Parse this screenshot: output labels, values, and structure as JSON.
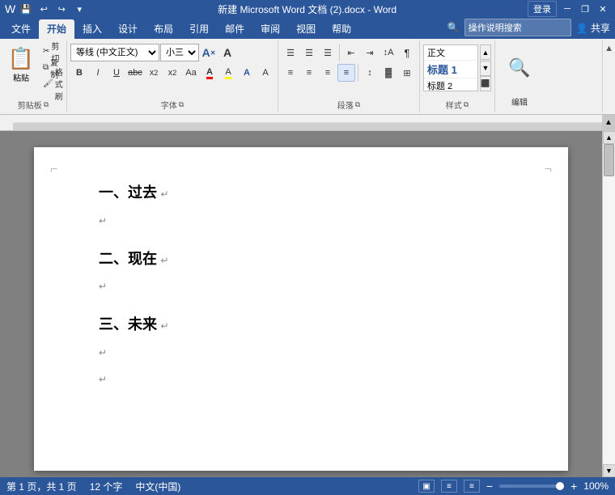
{
  "titlebar": {
    "title": "新建 Microsoft Word 文档 (2).docx - Word",
    "login_label": "登录",
    "app_name": "Word",
    "icons": {
      "save": "💾",
      "undo": "↩",
      "redo": "↪",
      "customize": "▼"
    },
    "window_controls": {
      "minimize": "─",
      "maximize": "□",
      "close": "✕",
      "restore": "❐"
    }
  },
  "ribbon_tabs": {
    "tabs": [
      {
        "id": "file",
        "label": "文件"
      },
      {
        "id": "home",
        "label": "开始",
        "active": true
      },
      {
        "id": "insert",
        "label": "插入"
      },
      {
        "id": "design",
        "label": "设计"
      },
      {
        "id": "layout",
        "label": "布局"
      },
      {
        "id": "references",
        "label": "引用"
      },
      {
        "id": "mailing",
        "label": "邮件"
      },
      {
        "id": "review",
        "label": "审阅"
      },
      {
        "id": "view",
        "label": "视图"
      },
      {
        "id": "help",
        "label": "帮助"
      }
    ]
  },
  "ribbon": {
    "groups": {
      "clipboard": {
        "label": "剪贴板",
        "paste_label": "粘贴",
        "cut_label": "剪切",
        "copy_label": "复制",
        "format_label": "格式刷"
      },
      "font": {
        "label": "字体",
        "font_name": "等线 (中文正文)",
        "font_size": "小三",
        "bold": "B",
        "italic": "I",
        "underline": "U",
        "strikethrough": "abc",
        "subscript": "x₂",
        "superscript": "x²",
        "clear_format": "A",
        "font_color_label": "A",
        "highlight_label": "A",
        "grow_font": "A",
        "shrink_font": "A",
        "change_case": "Aa",
        "text_effects": "A"
      },
      "paragraph": {
        "label": "段落",
        "bullets": "≡",
        "numbering": "≡",
        "multilevel": "≡",
        "decrease_indent": "⇤",
        "increase_indent": "⇥",
        "sort": "↕",
        "show_marks": "¶",
        "align_left": "≡",
        "align_center": "≡",
        "align_right": "≡",
        "justify": "≡",
        "line_spacing": "↕",
        "shading": "▓",
        "borders": "⊞"
      },
      "styles": {
        "label": "样式",
        "items": [
          "正文",
          "标题 1",
          "标题 2"
        ],
        "expand_label": "样式"
      },
      "editing": {
        "label": "编辑",
        "search_label": "🔍",
        "expand_label": "编辑"
      }
    }
  },
  "search": {
    "placeholder": "操作说明搜索",
    "icon": "🔍"
  },
  "share": {
    "label": "共享"
  },
  "document": {
    "lines": [
      {
        "type": "heading",
        "text": "一、过去"
      },
      {
        "type": "para",
        "text": ""
      },
      {
        "type": "heading",
        "text": "二、现在"
      },
      {
        "type": "para",
        "text": ""
      },
      {
        "type": "heading",
        "text": "三、未来"
      },
      {
        "type": "para",
        "text": ""
      },
      {
        "type": "para",
        "text": ""
      }
    ],
    "paragraph_mark": "↵"
  },
  "statusbar": {
    "page_info": "第 1 页，共 1 页",
    "word_count": "12 个字",
    "language": "中文(中国)",
    "zoom": "100%",
    "view_icons": [
      "▣",
      "≡",
      "≡"
    ]
  }
}
